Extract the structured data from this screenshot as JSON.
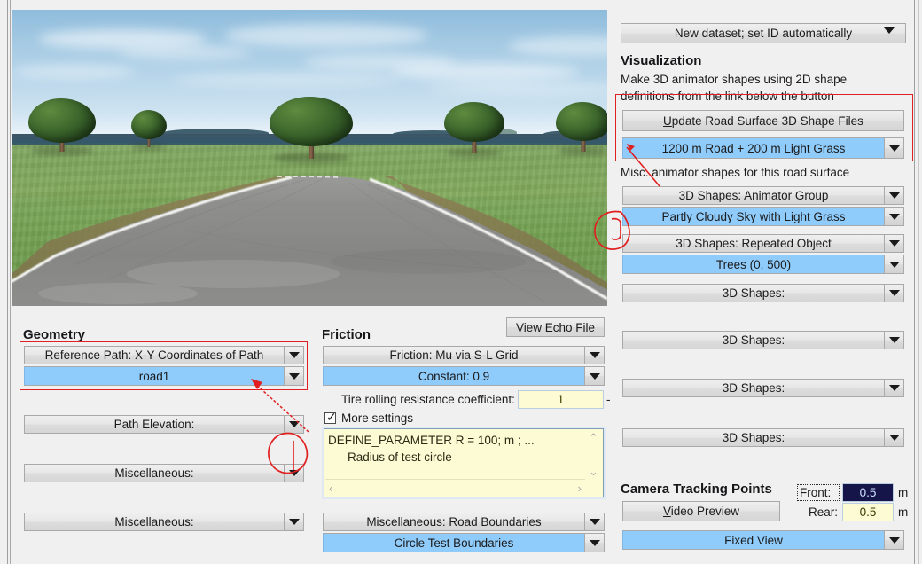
{
  "viewport": {
    "name": "3d-road-scene-preview",
    "description": "3D animator preview: curving asphalt road with white edge lines, light grass, trees and partly cloudy sky"
  },
  "right_panel": {
    "dataset_combo": "New dataset; set ID automatically",
    "visualization_title": "Visualization",
    "visualization_help_line1": "Make 3D animator shapes using 2D shape",
    "visualization_help_line2": "definitions from the link below the button",
    "update_button": {
      "accel": "U",
      "rest": "pdate Road Surface 3D Shape Files"
    },
    "road_surface_value": "1200 m Road + 200 m Light Grass",
    "misc_help": "Misc. animator shapes for this road surface",
    "shape_groups": [
      {
        "label": "3D Shapes: Animator Group",
        "value": "Partly Cloudy Sky with Light Grass"
      },
      {
        "label": "3D Shapes: Repeated Object",
        "value": "Trees (0, 500)"
      }
    ],
    "empty_shapes": [
      "3D Shapes:",
      "3D Shapes:",
      "3D Shapes:",
      "3D Shapes:"
    ],
    "camera": {
      "title": "Camera Tracking Points",
      "video_preview": {
        "accel": "V",
        "rest": "ideo Preview"
      },
      "front_label": "Front:",
      "front_value": "0.5",
      "front_unit": "m",
      "rear_label": "Rear:",
      "rear_value": "0.5",
      "rear_unit": "m",
      "view_mode": "Fixed View"
    }
  },
  "geometry": {
    "title": "Geometry",
    "reference_path_label": "Reference Path: X-Y Coordinates of Path",
    "reference_path_value": "road1",
    "path_elevation": "Path Elevation:",
    "misc_1": "Miscellaneous:",
    "misc_2": "Miscellaneous:"
  },
  "friction": {
    "title": "Friction",
    "view_echo_file": "View Echo File",
    "friction_label": "Friction: Mu via S-L Grid",
    "friction_value": "Constant: 0.9",
    "tire_label": "Tire rolling resistance coefficient:",
    "tire_value": "1",
    "tire_unit": "-",
    "more_settings": "More settings",
    "more_settings_checked": true,
    "editor_line1": "DEFINE_PARAMETER R =  100; m ; ...",
    "editor_line2": "Radius of test circle",
    "boundaries_label": "Miscellaneous: Road Boundaries",
    "boundaries_value": "Circle Test Boundaries"
  },
  "colors": {
    "highlight_blue": "#8fcbfb",
    "field_yellow": "#fcfbd4",
    "annotation_red": "#e02020",
    "panel_gray": "#f0f0f0",
    "selection_navy": "#15154a"
  },
  "annotations": {
    "rect_visualization": "red rectangle highlighting Update Road Surface 3D Shape Files button and road surface selector",
    "rect_geometry": "red rectangle highlighting Reference Path combo pair",
    "circle_near_viewport": "hand-drawn red circle with arrow pointing to Animator Group selector",
    "circle_near_elevation": "hand-drawn red circle with arrow pointing to reference path value"
  }
}
